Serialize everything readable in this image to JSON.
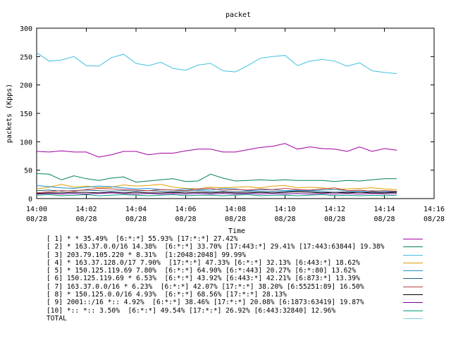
{
  "chart_data": {
    "type": "line",
    "title": "packet",
    "xlabel": "Time",
    "ylabel": "packets (Kpps)",
    "ylim": [
      0,
      300
    ],
    "yticks": [
      0,
      50,
      100,
      150,
      200,
      250,
      300
    ],
    "xlim": [
      "14:00",
      "14:16"
    ],
    "xticks": [
      {
        "time": "14:00",
        "date": "08/28"
      },
      {
        "time": "14:02",
        "date": "08/28"
      },
      {
        "time": "14:04",
        "date": "08/28"
      },
      {
        "time": "14:06",
        "date": "08/28"
      },
      {
        "time": "14:08",
        "date": "08/28"
      },
      {
        "time": "14:10",
        "date": "08/28"
      },
      {
        "time": "14:12",
        "date": "08/28"
      },
      {
        "time": "14:14",
        "date": "08/28"
      },
      {
        "time": "14:16",
        "date": "08/28"
      }
    ],
    "grid": false,
    "x": [
      "14:00:00",
      "14:00:30",
      "14:01:00",
      "14:01:30",
      "14:02:00",
      "14:02:30",
      "14:03:00",
      "14:03:30",
      "14:04:00",
      "14:04:30",
      "14:05:00",
      "14:05:30",
      "14:06:00",
      "14:06:30",
      "14:07:00",
      "14:07:30",
      "14:08:00",
      "14:08:30",
      "14:09:00",
      "14:09:30",
      "14:10:00",
      "14:10:30",
      "14:11:00",
      "14:11:30",
      "14:12:00",
      "14:12:30",
      "14:13:00",
      "14:13:30",
      "14:14:00",
      "14:14:30"
    ],
    "series": [
      {
        "name": "[ 1] * * 35.49%  [6:*:*] 55.93% [17:*:*] 27.42%",
        "color": "#a000a0",
        "values": [
          83,
          82,
          84,
          82,
          82,
          73,
          77,
          83,
          83,
          77,
          80,
          80,
          84,
          87,
          87,
          82,
          82,
          86,
          90,
          92,
          97,
          87,
          91,
          88,
          87,
          83,
          91,
          83,
          88,
          85
        ]
      },
      {
        "name": "[ 2] * 163.37.0.0/16 14.38%  [6:*:*] 33.70% [17:443:*] 29.41% [17:443:63844] 19.38%",
        "color": "#008060",
        "values": [
          44,
          43,
          33,
          40,
          35,
          32,
          36,
          38,
          29,
          31,
          33,
          35,
          30,
          31,
          43,
          36,
          31,
          32,
          33,
          32,
          33,
          32,
          32,
          32,
          30,
          32,
          31,
          33,
          35,
          35
        ]
      },
      {
        "name": "[ 3] 203.79.105.220 * 8.31%  [1:2048:2048] 99.99%",
        "color": "#40c0e0",
        "values": [
          257,
          242,
          244,
          250,
          234,
          233,
          248,
          254,
          238,
          234,
          240,
          229,
          226,
          235,
          238,
          225,
          223,
          234,
          247,
          250,
          252,
          234,
          242,
          245,
          242,
          233,
          239,
          225,
          222,
          220
        ]
      },
      {
        "name": "[ 4] * 163.37.128.0/17 7.90%  [17:*:*] 47.33% [6:*:*] 32.13% [6:443:*] 18.62%",
        "color": "#e0a000",
        "values": [
          17,
          20,
          25,
          20,
          22,
          19,
          20,
          24,
          22,
          23,
          25,
          20,
          18,
          17,
          20,
          19,
          20,
          21,
          19,
          22,
          23,
          19,
          20,
          19,
          16,
          17,
          18,
          19,
          17,
          16
        ]
      },
      {
        "name": "[ 5] * 150.125.119.69 7.80%  [6:*:*] 64.90% [6:*:443] 20.27% [6:*:80] 13.62%",
        "color": "#2090d0",
        "values": [
          23,
          21,
          19,
          18,
          20,
          22,
          21,
          19,
          17,
          18,
          16,
          15,
          17,
          16,
          15,
          18,
          17,
          14,
          15,
          16,
          14,
          15,
          14,
          15,
          16,
          14,
          13,
          14,
          13,
          12
        ]
      },
      {
        "name": "[ 6] 150.125.119.69 * 6.53%  [6:*:*] 43.92% [6:443:*] 42.21% [6:873:*] 13.39%",
        "color": "#206080",
        "values": [
          14,
          15,
          13,
          14,
          15,
          14,
          13,
          14,
          13,
          14,
          13,
          12,
          13,
          14,
          12,
          13,
          12,
          13,
          12,
          13,
          12,
          14,
          13,
          12,
          11,
          12,
          11,
          12,
          11,
          12
        ]
      },
      {
        "name": "[ 7] 163.37.0.0/16 * 6.23%  [6:*:*] 42.07% [17:*:*] 38.20% [6:55251:89] 16.50%",
        "color": "#c04040",
        "values": [
          10,
          12,
          14,
          13,
          16,
          18,
          17,
          16,
          15,
          14,
          16,
          15,
          14,
          17,
          18,
          15,
          16,
          15,
          17,
          16,
          18,
          16,
          15,
          17,
          19,
          14,
          15,
          13,
          14,
          13
        ]
      },
      {
        "name": "[ 8] * 150.125.0.0/16 4.93%  [6:*:*] 68.56% [17:*:*] 28.13%",
        "color": "#000000",
        "values": [
          9,
          10,
          10,
          11,
          11,
          10,
          11,
          10,
          11,
          10,
          10,
          11,
          10,
          11,
          10,
          11,
          10,
          10,
          11,
          10,
          11,
          12,
          11,
          10,
          11,
          10,
          11,
          10,
          10,
          11
        ]
      },
      {
        "name": "[ 9] 2001::/16 *:: 4.92%  [6:*:*] 38.46% [17:*:*] 20.08% [6:1873:63419] 19.87%",
        "color": "#8000a0",
        "values": [
          8,
          9,
          8,
          9,
          8,
          9,
          10,
          9,
          8,
          9,
          8,
          9,
          8,
          9,
          8,
          9,
          8,
          9,
          8,
          9,
          8,
          9,
          8,
          9,
          8,
          9,
          8,
          9,
          8,
          9
        ]
      },
      {
        "name": "[10] *:: *:: 3.50%  [6:*:*] 49.54% [17:*:*] 26.92% [6:443:32840] 12.96%",
        "color": "#00a080",
        "values": [
          6,
          7,
          5,
          6,
          7,
          5,
          6,
          7,
          6,
          5,
          6,
          7,
          5,
          6,
          6,
          5,
          6,
          7,
          5,
          6,
          6,
          5,
          6,
          7,
          5,
          6,
          5,
          6,
          5,
          6
        ]
      },
      {
        "name": "TOTAL",
        "color": "#80d0e0",
        "values": []
      }
    ]
  }
}
